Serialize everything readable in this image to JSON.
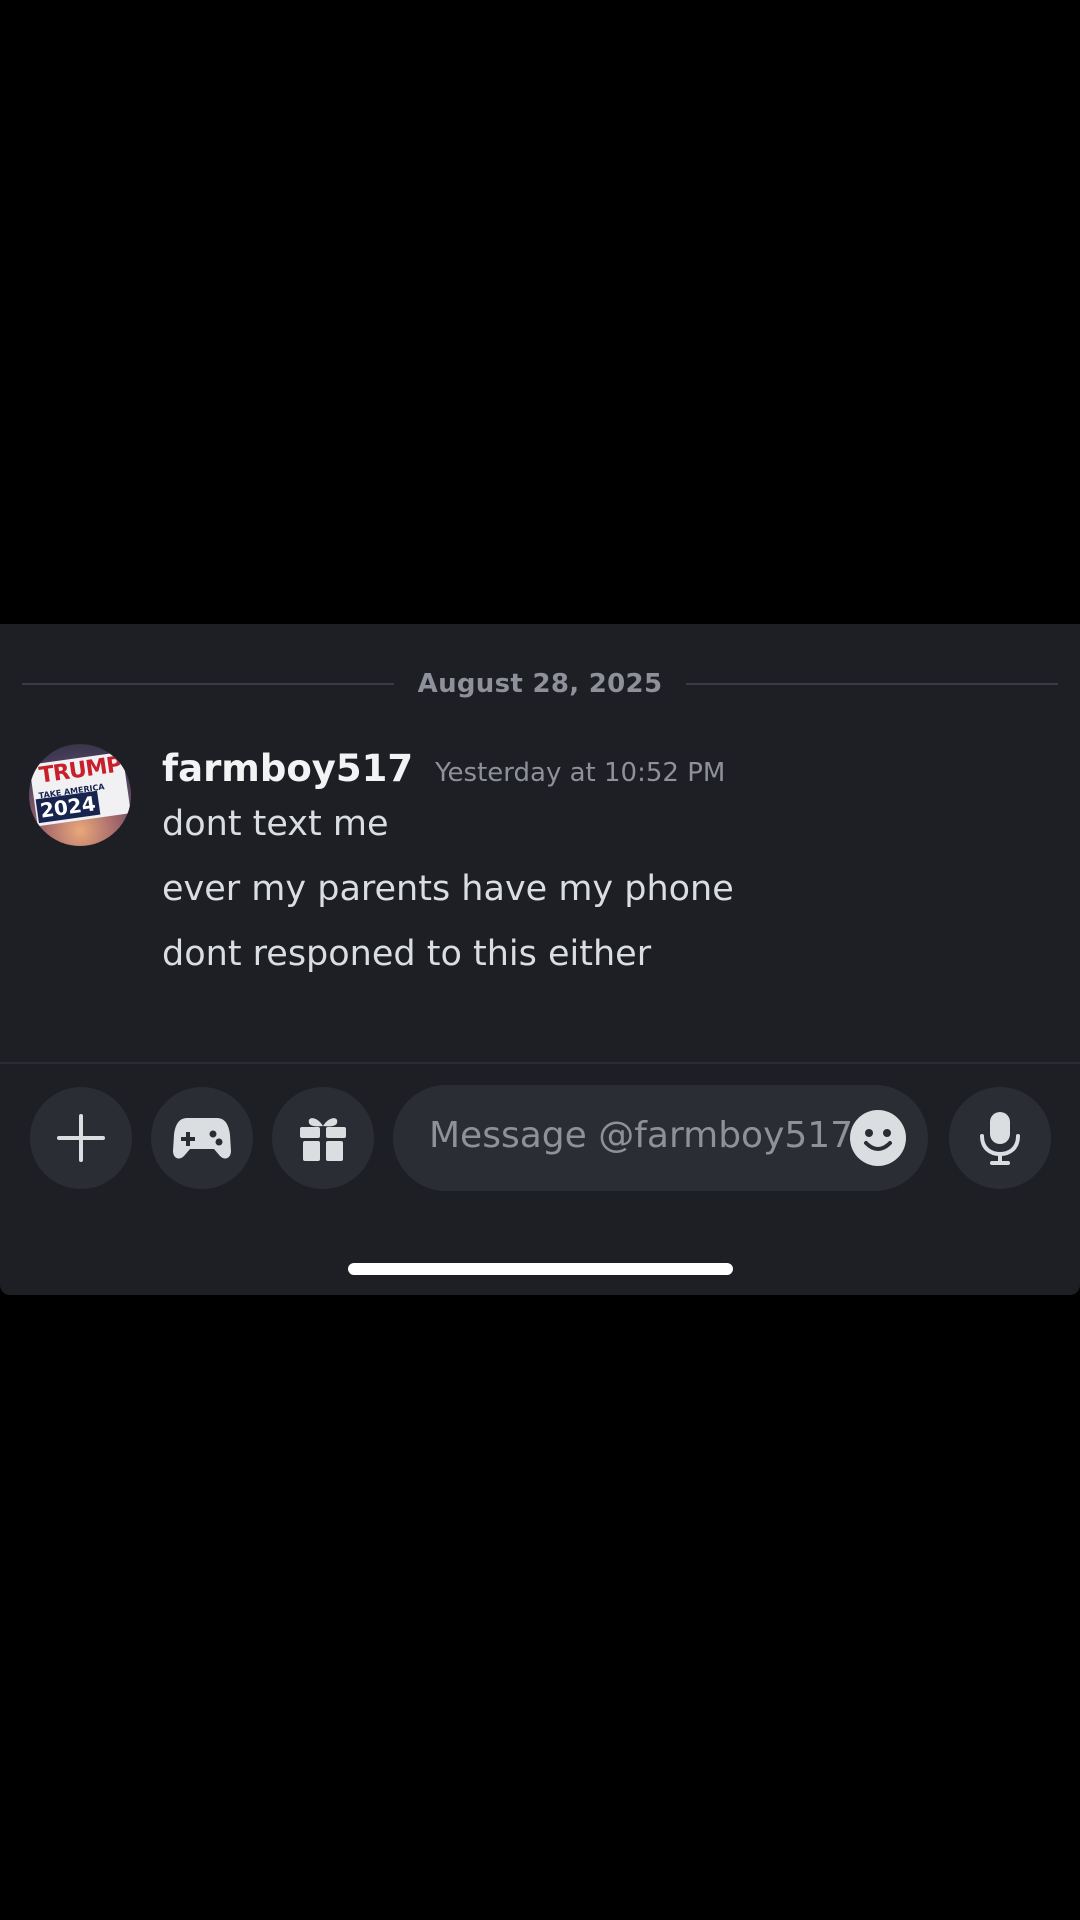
{
  "chat": {
    "date_divider": "August 28, 2025",
    "message": {
      "username": "farmboy517",
      "timestamp": "Yesterday at 10:52 PM",
      "lines": [
        "dont text me",
        "ever my parents have my phone",
        "dont responed to this either"
      ],
      "avatar": {
        "title_text": "TRUMP",
        "tagline": "TAKE AMERICA BACK",
        "year": "2024"
      }
    }
  },
  "composer": {
    "placeholder": "Message @farmboy517",
    "buttons": {
      "add": "plus-icon",
      "activities": "gamepad-icon",
      "gift": "gift-icon",
      "emoji": "emoji-icon",
      "voice": "microphone-icon"
    }
  },
  "colors": {
    "background": "#1e1f24",
    "button_bg": "#2b2d35",
    "icon": "#dbdee1",
    "muted_text": "#8e909a"
  }
}
